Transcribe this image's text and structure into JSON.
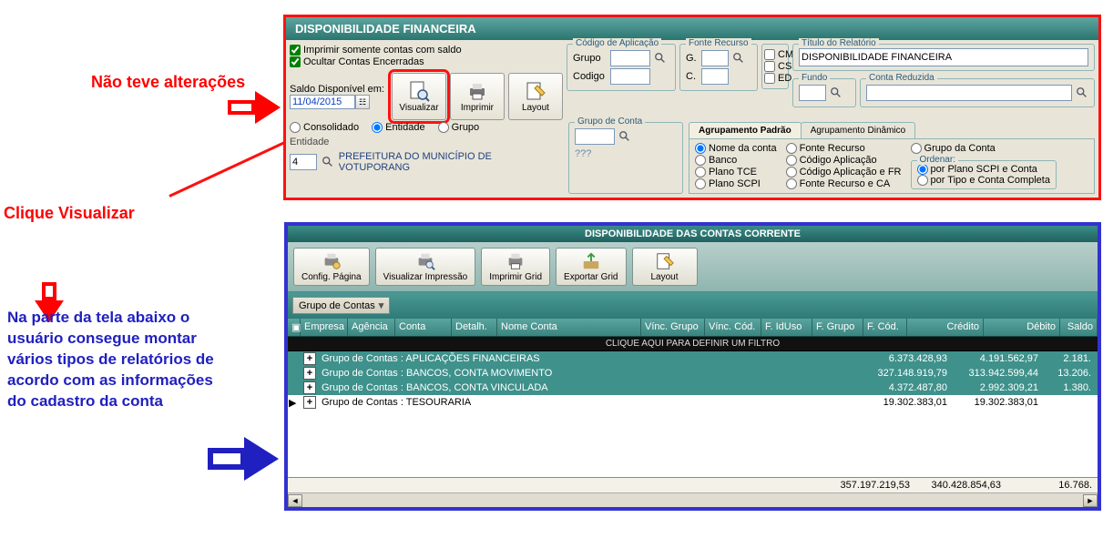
{
  "anno": {
    "red1": "Não teve alterações",
    "red2": "Clique Visualizar",
    "blue": "Na parte da tela abaixo o usuário consegue montar vários tipos de relatórios de acordo com as informações do cadastro da conta"
  },
  "top": {
    "title": "DISPONIBILIDADE FINANCEIRA",
    "chk1": "Imprimir somente contas com saldo",
    "chk2": "Ocultar Contas Encerradas",
    "saldo_label": "Saldo Disponível em:",
    "date": "11/04/2015",
    "btn_visualizar": "Visualizar",
    "btn_imprimir": "Imprimir",
    "btn_layout": "Layout",
    "cod_apl": {
      "legend": "Código de Aplicação",
      "grupo_lbl": "Grupo",
      "codigo_lbl": "Codigo"
    },
    "fonte": {
      "legend": "Fonte Recurso",
      "g_lbl": "G.",
      "c_lbl": "C."
    },
    "cks": {
      "cm": "CM",
      "cs": "CS",
      "ed": "ED"
    },
    "titulo": {
      "legend": "Título do Relatório",
      "value": "DISPONIBILIDADE FINANCEIRA"
    },
    "fundo_legend": "Fundo",
    "cred_legend": "Conta Reduzida",
    "r_consolidado": "Consolidado",
    "r_entidade": "Entidade",
    "r_grupo": "Grupo",
    "ent_label": "Entidade",
    "ent_val": "4",
    "ent_name": "PREFEITURA DO MUNICÍPIO DE VOTUPORANG",
    "gc_legend": "Grupo de Conta",
    "gc_q": "???",
    "tabs": {
      "a": "Agrupamento Padrão",
      "b": "Agrupamento Dinâmico"
    },
    "radios": {
      "nome": "Nome da conta",
      "banco": "Banco",
      "ptce": "Plano TCE",
      "pscpi": "Plano SCPI",
      "fr": "Fonte Recurso",
      "ca": "Código Aplicação",
      "cafr": "Código Aplicação e FR",
      "frca": "Fonte Recurso e CA",
      "gc": "Grupo da Conta"
    },
    "ord": {
      "legend": "Ordenar:",
      "a": "por Plano SCPI e Conta",
      "b": "por Tipo e Conta Completa"
    }
  },
  "lower": {
    "title": "DISPONIBILIDADE DAS CONTAS CORRENTE",
    "tb": {
      "cfg": "Config. Página",
      "vi": "Visualizar Impressão",
      "ig": "Imprimir Grid",
      "eg": "Exportar Grid",
      "ly": "Layout"
    },
    "chip": "Grupo de Contas",
    "headers": {
      "emp": "Empresa",
      "ag": "Agência",
      "cnt": "Conta",
      "det": "Detalh.",
      "nc": "Nome Conta",
      "vg": "Vínc. Grupo",
      "vc": "Vínc. Cód.",
      "fi": "F. IdUso",
      "fg": "F. Grupo",
      "fc": "F. Cód.",
      "cre": "Crédito",
      "deb": "Débito",
      "sal": "Saldo"
    },
    "filter": "CLIQUE AQUI PARA DEFINIR UM FILTRO",
    "rows": [
      {
        "label": "Grupo de Contas : APLICAÇÕES FINANCEIRAS",
        "cre": "6.373.428,93",
        "deb": "4.191.562,97",
        "sal": "2.181."
      },
      {
        "label": "Grupo de Contas : BANCOS, CONTA MOVIMENTO",
        "cre": "327.148.919,79",
        "deb": "313.942.599,44",
        "sal": "13.206."
      },
      {
        "label": "Grupo de Contas : BANCOS, CONTA VINCULADA",
        "cre": "4.372.487,80",
        "deb": "2.992.309,21",
        "sal": "1.380."
      },
      {
        "label": "Grupo de Contas : TESOURARIA",
        "cre": "19.302.383,01",
        "deb": "19.302.383,01",
        "sal": ""
      }
    ],
    "totals": {
      "cre": "357.197.219,53",
      "deb": "340.428.854,63",
      "sal": "16.768."
    }
  }
}
